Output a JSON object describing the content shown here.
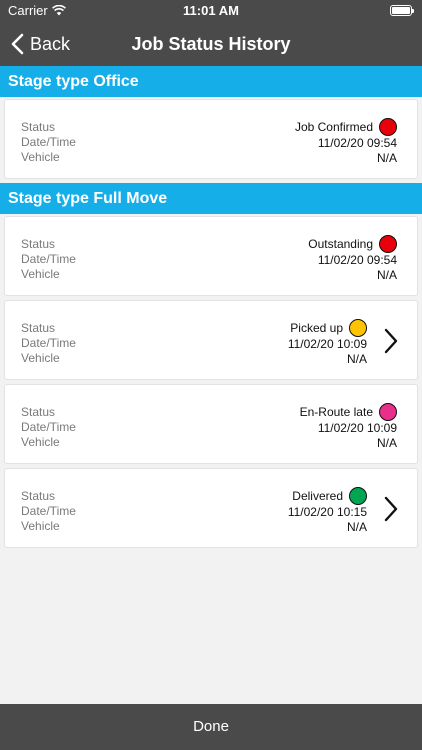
{
  "statusbar": {
    "carrier": "Carrier",
    "time": "11:01 AM"
  },
  "nav": {
    "back_label": "Back",
    "title": "Job Status History"
  },
  "labels": {
    "status": "Status",
    "datetime": "Date/Time",
    "vehicle": "Vehicle"
  },
  "sections": [
    {
      "title": "Stage type Office",
      "items": [
        {
          "status": "Job Confirmed",
          "datetime": "11/02/20 09:54",
          "vehicle": "N/A",
          "color": "#e8000b",
          "has_detail": false
        }
      ]
    },
    {
      "title": "Stage type Full Move",
      "items": [
        {
          "status": "Outstanding",
          "datetime": "11/02/20 09:54",
          "vehicle": "N/A",
          "color": "#e8000b",
          "has_detail": false
        },
        {
          "status": "Picked up",
          "datetime": "11/02/20 10:09",
          "vehicle": "N/A",
          "color": "#ffc400",
          "has_detail": true
        },
        {
          "status": "En-Route late",
          "datetime": "11/02/20 10:09",
          "vehicle": "N/A",
          "color": "#e8308a",
          "has_detail": false
        },
        {
          "status": "Delivered",
          "datetime": "11/02/20 10:15",
          "vehicle": "N/A",
          "color": "#00a651",
          "has_detail": true
        }
      ]
    }
  ],
  "footer": {
    "done_label": "Done"
  }
}
